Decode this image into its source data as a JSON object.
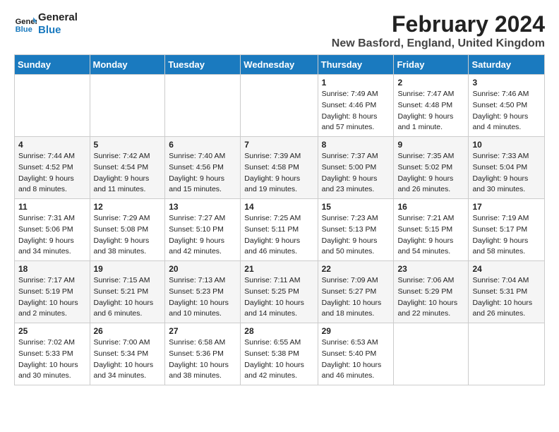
{
  "logo": {
    "line1": "General",
    "line2": "Blue"
  },
  "title": "February 2024",
  "location": "New Basford, England, United Kingdom",
  "weekdays": [
    "Sunday",
    "Monday",
    "Tuesday",
    "Wednesday",
    "Thursday",
    "Friday",
    "Saturday"
  ],
  "weeks": [
    [
      {
        "day": "",
        "sunrise": "",
        "sunset": "",
        "daylight": ""
      },
      {
        "day": "",
        "sunrise": "",
        "sunset": "",
        "daylight": ""
      },
      {
        "day": "",
        "sunrise": "",
        "sunset": "",
        "daylight": ""
      },
      {
        "day": "",
        "sunrise": "",
        "sunset": "",
        "daylight": ""
      },
      {
        "day": "1",
        "sunrise": "Sunrise: 7:49 AM",
        "sunset": "Sunset: 4:46 PM",
        "daylight": "Daylight: 8 hours and 57 minutes."
      },
      {
        "day": "2",
        "sunrise": "Sunrise: 7:47 AM",
        "sunset": "Sunset: 4:48 PM",
        "daylight": "Daylight: 9 hours and 1 minute."
      },
      {
        "day": "3",
        "sunrise": "Sunrise: 7:46 AM",
        "sunset": "Sunset: 4:50 PM",
        "daylight": "Daylight: 9 hours and 4 minutes."
      }
    ],
    [
      {
        "day": "4",
        "sunrise": "Sunrise: 7:44 AM",
        "sunset": "Sunset: 4:52 PM",
        "daylight": "Daylight: 9 hours and 8 minutes."
      },
      {
        "day": "5",
        "sunrise": "Sunrise: 7:42 AM",
        "sunset": "Sunset: 4:54 PM",
        "daylight": "Daylight: 9 hours and 11 minutes."
      },
      {
        "day": "6",
        "sunrise": "Sunrise: 7:40 AM",
        "sunset": "Sunset: 4:56 PM",
        "daylight": "Daylight: 9 hours and 15 minutes."
      },
      {
        "day": "7",
        "sunrise": "Sunrise: 7:39 AM",
        "sunset": "Sunset: 4:58 PM",
        "daylight": "Daylight: 9 hours and 19 minutes."
      },
      {
        "day": "8",
        "sunrise": "Sunrise: 7:37 AM",
        "sunset": "Sunset: 5:00 PM",
        "daylight": "Daylight: 9 hours and 23 minutes."
      },
      {
        "day": "9",
        "sunrise": "Sunrise: 7:35 AM",
        "sunset": "Sunset: 5:02 PM",
        "daylight": "Daylight: 9 hours and 26 minutes."
      },
      {
        "day": "10",
        "sunrise": "Sunrise: 7:33 AM",
        "sunset": "Sunset: 5:04 PM",
        "daylight": "Daylight: 9 hours and 30 minutes."
      }
    ],
    [
      {
        "day": "11",
        "sunrise": "Sunrise: 7:31 AM",
        "sunset": "Sunset: 5:06 PM",
        "daylight": "Daylight: 9 hours and 34 minutes."
      },
      {
        "day": "12",
        "sunrise": "Sunrise: 7:29 AM",
        "sunset": "Sunset: 5:08 PM",
        "daylight": "Daylight: 9 hours and 38 minutes."
      },
      {
        "day": "13",
        "sunrise": "Sunrise: 7:27 AM",
        "sunset": "Sunset: 5:10 PM",
        "daylight": "Daylight: 9 hours and 42 minutes."
      },
      {
        "day": "14",
        "sunrise": "Sunrise: 7:25 AM",
        "sunset": "Sunset: 5:11 PM",
        "daylight": "Daylight: 9 hours and 46 minutes."
      },
      {
        "day": "15",
        "sunrise": "Sunrise: 7:23 AM",
        "sunset": "Sunset: 5:13 PM",
        "daylight": "Daylight: 9 hours and 50 minutes."
      },
      {
        "day": "16",
        "sunrise": "Sunrise: 7:21 AM",
        "sunset": "Sunset: 5:15 PM",
        "daylight": "Daylight: 9 hours and 54 minutes."
      },
      {
        "day": "17",
        "sunrise": "Sunrise: 7:19 AM",
        "sunset": "Sunset: 5:17 PM",
        "daylight": "Daylight: 9 hours and 58 minutes."
      }
    ],
    [
      {
        "day": "18",
        "sunrise": "Sunrise: 7:17 AM",
        "sunset": "Sunset: 5:19 PM",
        "daylight": "Daylight: 10 hours and 2 minutes."
      },
      {
        "day": "19",
        "sunrise": "Sunrise: 7:15 AM",
        "sunset": "Sunset: 5:21 PM",
        "daylight": "Daylight: 10 hours and 6 minutes."
      },
      {
        "day": "20",
        "sunrise": "Sunrise: 7:13 AM",
        "sunset": "Sunset: 5:23 PM",
        "daylight": "Daylight: 10 hours and 10 minutes."
      },
      {
        "day": "21",
        "sunrise": "Sunrise: 7:11 AM",
        "sunset": "Sunset: 5:25 PM",
        "daylight": "Daylight: 10 hours and 14 minutes."
      },
      {
        "day": "22",
        "sunrise": "Sunrise: 7:09 AM",
        "sunset": "Sunset: 5:27 PM",
        "daylight": "Daylight: 10 hours and 18 minutes."
      },
      {
        "day": "23",
        "sunrise": "Sunrise: 7:06 AM",
        "sunset": "Sunset: 5:29 PM",
        "daylight": "Daylight: 10 hours and 22 minutes."
      },
      {
        "day": "24",
        "sunrise": "Sunrise: 7:04 AM",
        "sunset": "Sunset: 5:31 PM",
        "daylight": "Daylight: 10 hours and 26 minutes."
      }
    ],
    [
      {
        "day": "25",
        "sunrise": "Sunrise: 7:02 AM",
        "sunset": "Sunset: 5:33 PM",
        "daylight": "Daylight: 10 hours and 30 minutes."
      },
      {
        "day": "26",
        "sunrise": "Sunrise: 7:00 AM",
        "sunset": "Sunset: 5:34 PM",
        "daylight": "Daylight: 10 hours and 34 minutes."
      },
      {
        "day": "27",
        "sunrise": "Sunrise: 6:58 AM",
        "sunset": "Sunset: 5:36 PM",
        "daylight": "Daylight: 10 hours and 38 minutes."
      },
      {
        "day": "28",
        "sunrise": "Sunrise: 6:55 AM",
        "sunset": "Sunset: 5:38 PM",
        "daylight": "Daylight: 10 hours and 42 minutes."
      },
      {
        "day": "29",
        "sunrise": "Sunrise: 6:53 AM",
        "sunset": "Sunset: 5:40 PM",
        "daylight": "Daylight: 10 hours and 46 minutes."
      },
      {
        "day": "",
        "sunrise": "",
        "sunset": "",
        "daylight": ""
      },
      {
        "day": "",
        "sunrise": "",
        "sunset": "",
        "daylight": ""
      }
    ]
  ]
}
